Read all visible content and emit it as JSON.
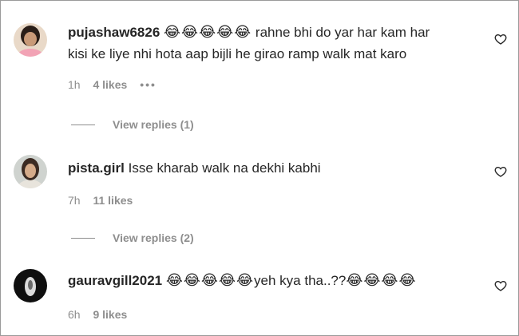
{
  "comments": [
    {
      "username": "pujashaw6826",
      "emoji_prefix": "😂😂😂😂😂",
      "text_line1": "rahne bhi do yar har kam har",
      "text_line2": "kisi ke liye nhi hota aap bijli he girao ramp walk mat karo",
      "time": "1h",
      "likes": "4 likes",
      "more": "•••",
      "replies": "View replies (1)"
    },
    {
      "username": "pista.girl",
      "text": "Isse kharab walk na dekhi kabhi",
      "time": "7h",
      "likes": "11 likes",
      "replies": "View replies (2)"
    },
    {
      "username": "gauravgill2021",
      "emoji_prefix": "😂😂😂😂😂",
      "text": "yeh kya tha..??",
      "emoji_suffix": "😂😂😂😂",
      "time": "6h",
      "likes": "9 likes"
    }
  ],
  "colors": {
    "primary_text": "#262626",
    "secondary_text": "#8e8e8e"
  },
  "icons": [
    "avatar",
    "heart-icon",
    "more-options-icon"
  ]
}
